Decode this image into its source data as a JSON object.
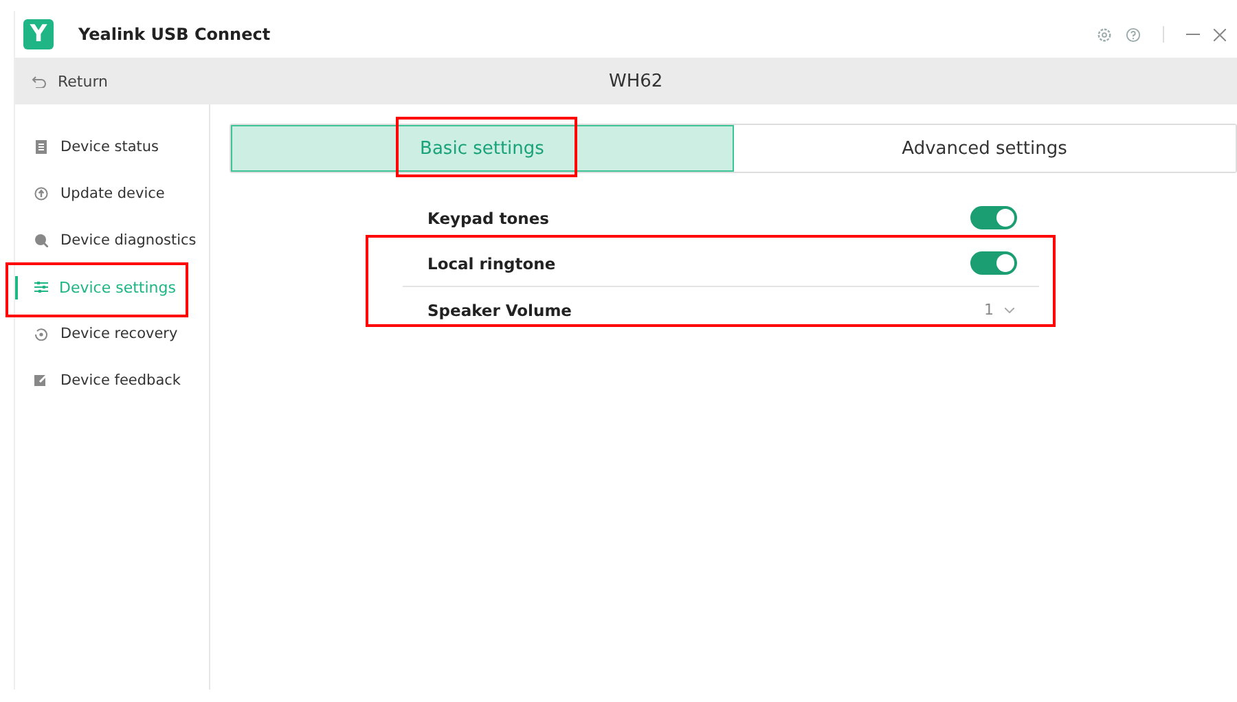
{
  "window": {
    "title": "Yealink USB Connect",
    "logo": "Y"
  },
  "header": {
    "return_label": "Return",
    "device": "WH62"
  },
  "sidebar": {
    "items": [
      {
        "label": "Device status",
        "selected": false,
        "annotated": false
      },
      {
        "label": "Update device",
        "selected": false,
        "annotated": false
      },
      {
        "label": "Device diagnostics",
        "selected": false,
        "annotated": false
      },
      {
        "label": "Device settings",
        "selected": true,
        "annotated": true
      },
      {
        "label": "Device recovery",
        "selected": false,
        "annotated": false
      },
      {
        "label": "Device feedback",
        "selected": false,
        "annotated": false
      }
    ]
  },
  "tabs": [
    {
      "label": "Basic settings",
      "selected": true,
      "annotated": true
    },
    {
      "label": "Advanced settings",
      "selected": false,
      "annotated": false
    }
  ],
  "settings": {
    "groups": [
      {
        "annotated": false,
        "rows": [
          {
            "kind": "toggle",
            "label": "Keypad tones",
            "on": true
          }
        ]
      },
      {
        "annotated": true,
        "rows": [
          {
            "kind": "toggle",
            "label": "Local ringtone",
            "on": true
          },
          {
            "kind": "select",
            "label": "Speaker Volume",
            "value": "1"
          }
        ]
      }
    ]
  }
}
